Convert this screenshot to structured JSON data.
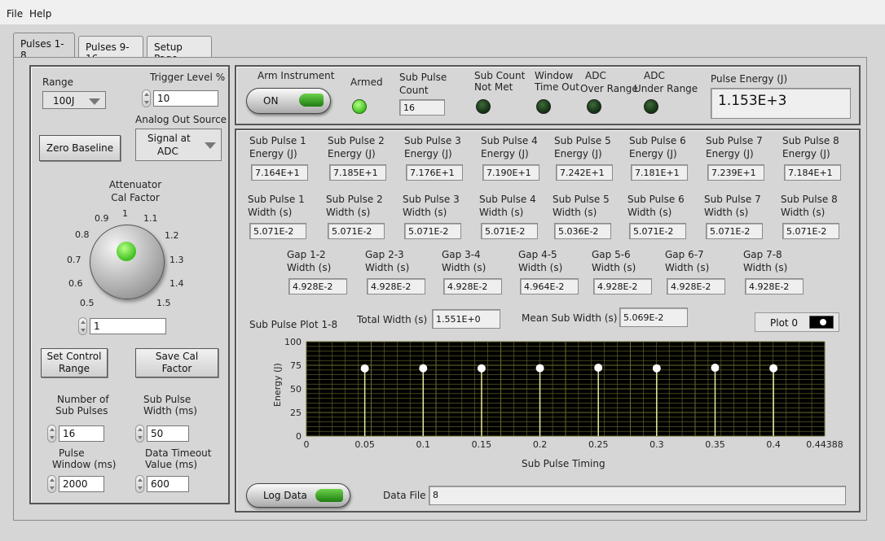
{
  "menu": {
    "file": "File",
    "help": "Help"
  },
  "tabs": [
    "Pulses 1-8",
    "Pulses 9-16",
    "Setup Page"
  ],
  "left": {
    "range_label": "Range",
    "range_value": "100J",
    "trigger_label": "Trigger Level %",
    "trigger_value": "10",
    "analog_label": "Analog Out Source",
    "analog_value_1": "Signal at",
    "analog_value_2": "ADC",
    "zero_baseline": "Zero Baseline",
    "attenuator_label_1": "Attenuator",
    "attenuator_label_2": "Cal Factor",
    "knob_ticks": [
      "0.5",
      "0.6",
      "0.7",
      "0.8",
      "0.9",
      "1",
      "1.1",
      "1.2",
      "1.3",
      "1.4",
      "1.5"
    ],
    "knob_value": "1",
    "set_control_1": "Set Control",
    "set_control_2": "Range",
    "save_cal_1": "Save Cal",
    "save_cal_2": "Factor",
    "num_sub_label_1": "Number of",
    "num_sub_label_2": "Sub Pulses",
    "num_sub_value": "16",
    "sub_width_label_1": "Sub Pulse",
    "sub_width_label_2": "Width (ms)",
    "sub_width_value": "50",
    "pulse_window_label_1": "Pulse",
    "pulse_window_label_2": "Window (ms)",
    "pulse_window_value": "2000",
    "timeout_label_1": "Data Timeout",
    "timeout_label_2": "Value (ms)",
    "timeout_value": "600"
  },
  "top": {
    "arm_label": "Arm Instrument",
    "arm_button": "ON",
    "armed_label": "Armed",
    "sub_count_label_1": "Sub Pulse",
    "sub_count_label_2": "Count",
    "sub_count_value": "16",
    "not_met_1": "Sub Count",
    "not_met_2": "Not Met",
    "window_timeout_1": "Window",
    "window_timeout_2": "Time Out",
    "adc_over_1": "ADC",
    "adc_over_2": "Over Range",
    "adc_under_1": "ADC",
    "adc_under_2": "Under Range",
    "pulse_energy_label": "Pulse Energy (J)",
    "pulse_energy_value": "1.153E+3"
  },
  "energies": [
    {
      "l1": "Sub Pulse 1",
      "l2": "Energy (J)",
      "v": "7.164E+1"
    },
    {
      "l1": "Sub Pulse 2",
      "l2": "Energy (J)",
      "v": "7.185E+1"
    },
    {
      "l1": "Sub Pulse 3",
      "l2": "Energy (J)",
      "v": "7.176E+1"
    },
    {
      "l1": "Sub Pulse 4",
      "l2": "Energy (J)",
      "v": "7.190E+1"
    },
    {
      "l1": "Sub Pulse 5",
      "l2": "Energy (J)",
      "v": "7.242E+1"
    },
    {
      "l1": "Sub Pulse 6",
      "l2": "Energy (J)",
      "v": "7.181E+1"
    },
    {
      "l1": "Sub Pulse 7",
      "l2": "Energy (J)",
      "v": "7.239E+1"
    },
    {
      "l1": "Sub Pulse 8",
      "l2": "Energy (J)",
      "v": "7.184E+1"
    }
  ],
  "widths": [
    {
      "l1": "Sub Pulse 1",
      "l2": "Width (s)",
      "v": "5.071E-2"
    },
    {
      "l1": "Sub Pulse 2",
      "l2": "Width (s)",
      "v": "5.071E-2"
    },
    {
      "l1": "Sub Pulse 3",
      "l2": "Width (s)",
      "v": "5.071E-2"
    },
    {
      "l1": "Sub Pulse 4",
      "l2": "Width (s)",
      "v": "5.071E-2"
    },
    {
      "l1": "Sub Pulse 5",
      "l2": "Width (s)",
      "v": "5.036E-2"
    },
    {
      "l1": "Sub Pulse 6",
      "l2": "Width (s)",
      "v": "5.071E-2"
    },
    {
      "l1": "Sub Pulse 7",
      "l2": "Width (s)",
      "v": "5.071E-2"
    },
    {
      "l1": "Sub Pulse 8",
      "l2": "Width (s)",
      "v": "5.071E-2"
    }
  ],
  "gaps": [
    {
      "l1": "Gap 1-2",
      "l2": "Width (s)",
      "v": "4.928E-2"
    },
    {
      "l1": "Gap 2-3",
      "l2": "Width (s)",
      "v": "4.928E-2"
    },
    {
      "l1": "Gap 3-4",
      "l2": "Width (s)",
      "v": "4.928E-2"
    },
    {
      "l1": "Gap 4-5",
      "l2": "Width (s)",
      "v": "4.964E-2"
    },
    {
      "l1": "Gap 5-6",
      "l2": "Width (s)",
      "v": "4.928E-2"
    },
    {
      "l1": "Gap 6-7",
      "l2": "Width (s)",
      "v": "4.928E-2"
    },
    {
      "l1": "Gap 7-8",
      "l2": "Width (s)",
      "v": "4.928E-2"
    }
  ],
  "plot": {
    "title": "Sub Pulse Plot 1-8",
    "total_width_label": "Total Width (s)",
    "total_width_value": "1.551E+0",
    "mean_width_label": "Mean Sub Width (s)",
    "mean_width_value": "5.069E-2",
    "legend_label": "Plot 0",
    "ylabel": "Energy (J)",
    "xlabel": "Sub Pulse Timing"
  },
  "chart_data": {
    "type": "scatter",
    "xlabel": "Sub Pulse Timing",
    "ylabel": "Energy (J)",
    "xlim": [
      0,
      0.44388
    ],
    "ylim": [
      0,
      100
    ],
    "x_ticks": [
      "0",
      "0.05",
      "0.1",
      "0.15",
      "0.2",
      "0.25",
      "0.3",
      "0.35",
      "0.4",
      "0.44388"
    ],
    "y_ticks": [
      "0",
      "25",
      "50",
      "75",
      "100"
    ],
    "grid": true,
    "plot_bg": "#000000",
    "grid_color": "#6b6b2e",
    "marker_color": "#ffffff",
    "series": [
      {
        "name": "Plot 0",
        "x": [
          0.05,
          0.1,
          0.15,
          0.2,
          0.25,
          0.3,
          0.35,
          0.4
        ],
        "y": [
          71.64,
          71.85,
          71.76,
          71.9,
          72.42,
          71.81,
          72.39,
          71.84
        ]
      }
    ]
  },
  "footer": {
    "log_data": "Log Data",
    "data_file_label": "Data File",
    "data_file_value": "8"
  }
}
